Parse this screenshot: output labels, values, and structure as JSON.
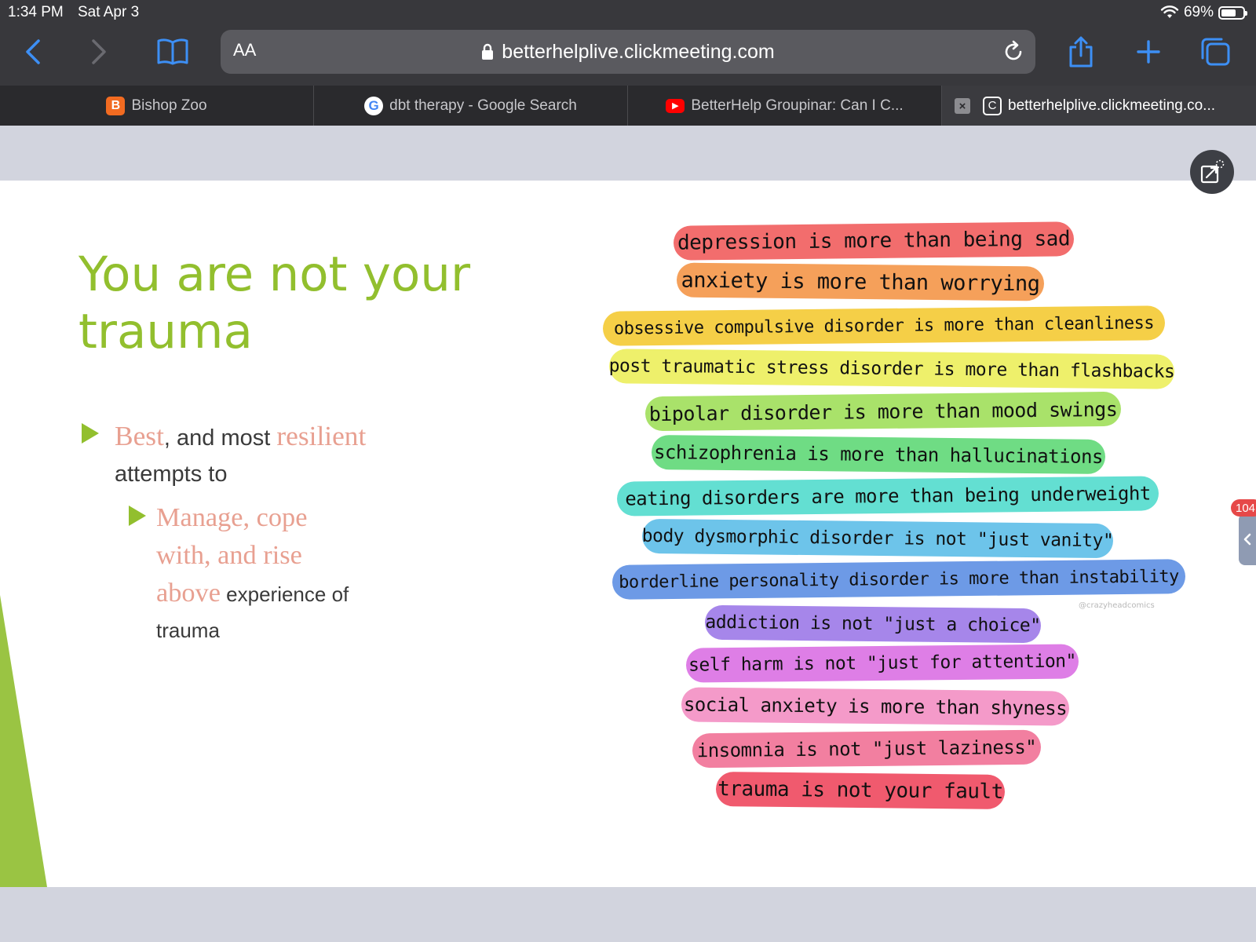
{
  "status_bar": {
    "time": "1:34 PM",
    "date": "Sat Apr 3",
    "battery": "69%",
    "battery_level": 0.69
  },
  "toolbar": {
    "aa_label": "AA",
    "url": "betterhelplive.clickmeeting.com",
    "icons": [
      "chevron-left-icon",
      "chevron-right-icon",
      "book-icon",
      "lock-icon",
      "reload-icon",
      "share-icon",
      "plus-icon",
      "tabs-icon"
    ]
  },
  "tabs": [
    {
      "label": "Bishop Zoo",
      "favicon": "B",
      "favicon_color": "#f26b21"
    },
    {
      "label": "dbt therapy - Google Search",
      "favicon": "G",
      "favicon_color": "#ffffff"
    },
    {
      "label": "BetterHelp Groupinar: Can I C...",
      "favicon": "▶",
      "favicon_color": "#ff0000"
    },
    {
      "label": "betterhelplive.clickmeeting.co...",
      "favicon": "C",
      "favicon_color": "#3b3b3f"
    }
  ],
  "slide": {
    "title": "You are not your trauma",
    "bullet1": {
      "accent1": "Best",
      "text1": ", and most ",
      "accent2": "resilient",
      "text2": " attempts to"
    },
    "bullet2": {
      "accent": "Manage, cope with, and rise above",
      "text": " experience of trauma"
    },
    "illustration": {
      "credit": "@crazyheadcomics",
      "lines": [
        {
          "text": "depression is more than being sad",
          "color": "#f26d6d"
        },
        {
          "text": "anxiety is more than worrying",
          "color": "#f5a05a"
        },
        {
          "text": "obsessive compulsive disorder is more than cleanliness",
          "color": "#f5cf47"
        },
        {
          "text": "post traumatic stress disorder is more than flashbacks",
          "color": "#eef06b"
        },
        {
          "text": "bipolar disorder is more than mood swings",
          "color": "#a9e26a"
        },
        {
          "text": "schizophrenia is more than hallucinations",
          "color": "#6fdc84"
        },
        {
          "text": "eating disorders are more than being underweight",
          "color": "#63dfd2"
        },
        {
          "text": "body dysmorphic disorder is not \"just vanity\"",
          "color": "#6dc4ea"
        },
        {
          "text": "borderline personality disorder is more than instability",
          "color": "#6d9ae6"
        },
        {
          "text": "addiction is not \"just a choice\"",
          "color": "#a686ea"
        },
        {
          "text": "self harm is not \"just for attention\"",
          "color": "#de7ee6"
        },
        {
          "text": "social anxiety is more than shyness",
          "color": "#f49ac9"
        },
        {
          "text": "insomnia is not \"just laziness\"",
          "color": "#f27fa0"
        },
        {
          "text": "trauma is not your fault",
          "color": "#f05a6e"
        }
      ]
    }
  },
  "side_badge": "104"
}
